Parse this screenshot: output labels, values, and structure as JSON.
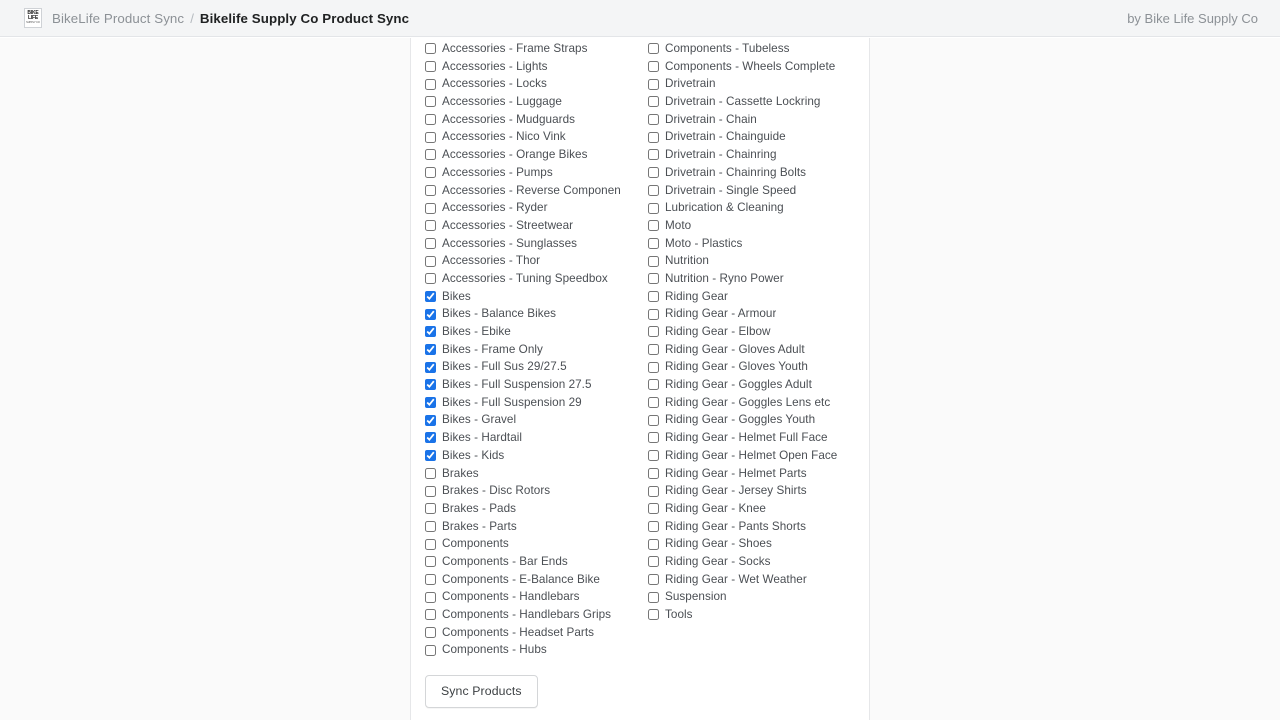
{
  "header": {
    "logo_icon": "bikelife-logo-icon",
    "logo_line1": "BIKE",
    "logo_line2": "LIFE",
    "logo_line3": "SUPPLY CO",
    "breadcrumb_parent": "BikeLife Product Sync",
    "breadcrumb_separator": "/",
    "breadcrumb_current": "Bikelife Supply Co Product Sync",
    "credit": "by Bike Life Supply Co"
  },
  "colors": {
    "header_bg": "#f4f5f6",
    "page_bg": "#fafafa",
    "card_bg": "#ffffff",
    "checkbox_accent": "#1a73e8",
    "label_text": "#4b4f54",
    "muted_text": "#8c9196"
  },
  "collections": {
    "left_column": [
      {
        "label": "Accessories - Frame Straps",
        "checked": false
      },
      {
        "label": "Accessories - Lights",
        "checked": false
      },
      {
        "label": "Accessories - Locks",
        "checked": false
      },
      {
        "label": "Accessories - Luggage",
        "checked": false
      },
      {
        "label": "Accessories - Mudguards",
        "checked": false
      },
      {
        "label": "Accessories - Nico Vink",
        "checked": false
      },
      {
        "label": "Accessories - Orange Bikes",
        "checked": false
      },
      {
        "label": "Accessories - Pumps",
        "checked": false
      },
      {
        "label": "Accessories - Reverse Componen",
        "checked": false
      },
      {
        "label": "Accessories - Ryder",
        "checked": false
      },
      {
        "label": "Accessories - Streetwear",
        "checked": false
      },
      {
        "label": "Accessories - Sunglasses",
        "checked": false
      },
      {
        "label": "Accessories - Thor",
        "checked": false
      },
      {
        "label": "Accessories - Tuning Speedbox",
        "checked": false
      },
      {
        "label": "Bikes",
        "checked": true
      },
      {
        "label": "Bikes - Balance Bikes",
        "checked": true
      },
      {
        "label": "Bikes - Ebike",
        "checked": true
      },
      {
        "label": "Bikes - Frame Only",
        "checked": true
      },
      {
        "label": "Bikes - Full Sus 29/27.5",
        "checked": true
      },
      {
        "label": "Bikes - Full Suspension 27.5",
        "checked": true
      },
      {
        "label": "Bikes - Full Suspension 29",
        "checked": true
      },
      {
        "label": "Bikes - Gravel",
        "checked": true
      },
      {
        "label": "Bikes - Hardtail",
        "checked": true
      },
      {
        "label": "Bikes - Kids",
        "checked": true
      },
      {
        "label": "Brakes",
        "checked": false
      },
      {
        "label": "Brakes - Disc Rotors",
        "checked": false
      },
      {
        "label": "Brakes - Pads",
        "checked": false
      },
      {
        "label": "Brakes - Parts",
        "checked": false
      },
      {
        "label": "Components",
        "checked": false
      },
      {
        "label": "Components - Bar Ends",
        "checked": false
      },
      {
        "label": "Components - E-Balance Bike",
        "checked": false
      },
      {
        "label": "Components - Handlebars",
        "checked": false
      },
      {
        "label": "Components - Handlebars Grips",
        "checked": false
      },
      {
        "label": "Components - Headset Parts",
        "checked": false
      },
      {
        "label": "Components - Hubs",
        "checked": false
      }
    ],
    "right_column": [
      {
        "label": "Components - Tubeless",
        "checked": false
      },
      {
        "label": "Components - Wheels Complete",
        "checked": false
      },
      {
        "label": "Drivetrain",
        "checked": false
      },
      {
        "label": "Drivetrain - Cassette Lockring",
        "checked": false
      },
      {
        "label": "Drivetrain - Chain",
        "checked": false
      },
      {
        "label": "Drivetrain - Chainguide",
        "checked": false
      },
      {
        "label": "Drivetrain - Chainring",
        "checked": false
      },
      {
        "label": "Drivetrain - Chainring Bolts",
        "checked": false
      },
      {
        "label": "Drivetrain - Single Speed",
        "checked": false
      },
      {
        "label": "Lubrication & Cleaning",
        "checked": false
      },
      {
        "label": "Moto",
        "checked": false
      },
      {
        "label": "Moto - Plastics",
        "checked": false
      },
      {
        "label": "Nutrition",
        "checked": false
      },
      {
        "label": "Nutrition - Ryno Power",
        "checked": false
      },
      {
        "label": "Riding Gear",
        "checked": false
      },
      {
        "label": "Riding Gear - Armour",
        "checked": false
      },
      {
        "label": "Riding Gear - Elbow",
        "checked": false
      },
      {
        "label": "Riding Gear - Gloves Adult",
        "checked": false
      },
      {
        "label": "Riding Gear - Gloves Youth",
        "checked": false
      },
      {
        "label": "Riding Gear - Goggles Adult",
        "checked": false
      },
      {
        "label": "Riding Gear - Goggles Lens etc",
        "checked": false
      },
      {
        "label": "Riding Gear - Goggles Youth",
        "checked": false
      },
      {
        "label": "Riding Gear - Helmet Full Face",
        "checked": false
      },
      {
        "label": "Riding Gear - Helmet Open Face",
        "checked": false
      },
      {
        "label": "Riding Gear - Helmet Parts",
        "checked": false
      },
      {
        "label": "Riding Gear - Jersey Shirts",
        "checked": false
      },
      {
        "label": "Riding Gear - Knee",
        "checked": false
      },
      {
        "label": "Riding Gear - Pants Shorts",
        "checked": false
      },
      {
        "label": "Riding Gear - Shoes",
        "checked": false
      },
      {
        "label": "Riding Gear - Socks",
        "checked": false
      },
      {
        "label": "Riding Gear - Wet Weather",
        "checked": false
      },
      {
        "label": "Suspension",
        "checked": false
      },
      {
        "label": "Tools",
        "checked": false
      }
    ]
  },
  "actions": {
    "sync_label": "Sync Products"
  }
}
